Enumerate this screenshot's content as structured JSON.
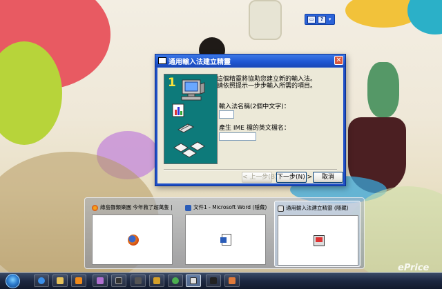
{
  "dialog": {
    "title": "通用輸入法建立精靈",
    "intro_line1": "這個精靈將協助您建立新的輸入法。",
    "intro_line2": "請依照提示一步步輸入所需的項目。",
    "name_label": "輸入法名稱(2個中文字)：",
    "name_value": "",
    "ime_label": "產生 IME 檔的英文檔名：",
    "ime_value": "",
    "step_number": "1",
    "back_button": "< 上一步(B)",
    "next_button": "下一步(N) >",
    "cancel_button": "取消"
  },
  "thumbnails": [
    {
      "title": "綠島聲類樂園 今年救了超萬隻 | ...",
      "icon": "firefox-icon",
      "active": false
    },
    {
      "title": "文件1 - Microsoft Word (隱藏)",
      "icon": "word-icon",
      "active": false
    },
    {
      "title": "通用輸入法建立精靈 (隱藏)",
      "icon": "ime-wizard-icon",
      "active": true
    }
  ],
  "taskbar": {
    "items": [
      "internet-explorer-icon",
      "explorer-icon",
      "media-player-icon",
      "image-icon",
      "film-icon",
      "game-icon",
      "trophy-icon",
      "frog-icon",
      "ime-app-icon",
      "tool-icon",
      "picture-icon"
    ]
  },
  "watermark": "ePrice",
  "colors": {
    "title_bar": "#1f56d2",
    "wizard_pane": "#0d7a7a",
    "dialog_face": "#ece9d8",
    "taskbar": "#1c2740"
  }
}
